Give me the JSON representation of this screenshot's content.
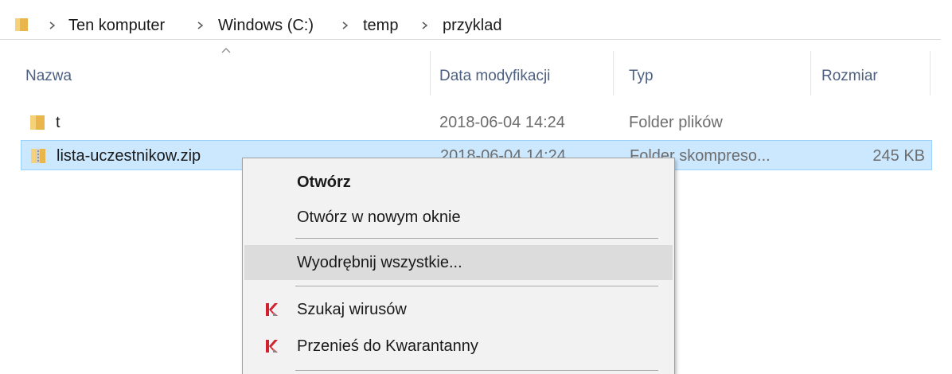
{
  "breadcrumb": {
    "items": [
      "Ten komputer",
      "Windows (C:)",
      "temp",
      "przyklad"
    ]
  },
  "columns": {
    "name": "Nazwa",
    "date": "Data modyfikacji",
    "type": "Typ",
    "size": "Rozmiar"
  },
  "files": [
    {
      "name": "t",
      "date": "2018-06-04 14:24",
      "type": "Folder plików",
      "size": "",
      "icon": "folder-icon"
    },
    {
      "name": "lista-uczestnikow.zip",
      "date": "2018-06-04 14:24",
      "type": "Folder skompreso...",
      "size": "245 KB",
      "icon": "zip-folder-icon",
      "selected": true
    }
  ],
  "context_menu": {
    "items": [
      {
        "label": "Otwórz",
        "bold": true
      },
      {
        "label": "Otwórz w nowym oknie"
      },
      {
        "label": "Wyodrębnij wszystkie...",
        "hover": true
      },
      {
        "label": "Szukaj wirusów",
        "icon": "kaspersky-icon"
      },
      {
        "label": "Przenieś do Kwarantanny",
        "icon": "kaspersky-icon"
      }
    ]
  },
  "colors": {
    "selection": "#cce8ff",
    "selection_border": "#99d1ff",
    "header_text": "#4d6082",
    "menu_bg": "#f2f2f2",
    "menu_hover": "#dcdcdc",
    "folder": "#e8b64a",
    "kaspersky": "#d2202f"
  }
}
